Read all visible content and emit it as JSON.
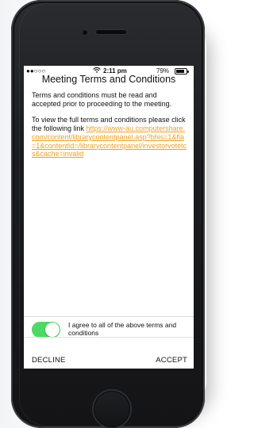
{
  "status_bar": {
    "signal": "●●○○○",
    "wifi_icon": "wifi-icon",
    "time": "2:11 pm",
    "battery_percent": "79%",
    "battery_icon": "battery-icon"
  },
  "screen": {
    "title": "Meeting Terms and Conditions",
    "paragraph_1": "Terms and conditions must be read and accepted prior to proceeding to the meeting.",
    "paragraph_2_prefix": "To view the full terms and conditions please click the following link ",
    "link_text": "https://www-au.computershare.com/content/librarycontentpanel.asp?bhis=1&fla=1&contentId=/librarycontentpanel/investorvotetcs&cache=invalid"
  },
  "agree": {
    "toggle_on": true,
    "label": "I agree to all of the above terms and conditions"
  },
  "buttons": {
    "decline": "DECLINE",
    "accept": "ACCEPT"
  },
  "colors": {
    "link": "#f0a01a",
    "toggle_on": "#4cd964",
    "phone_body": "#1c1d20"
  }
}
